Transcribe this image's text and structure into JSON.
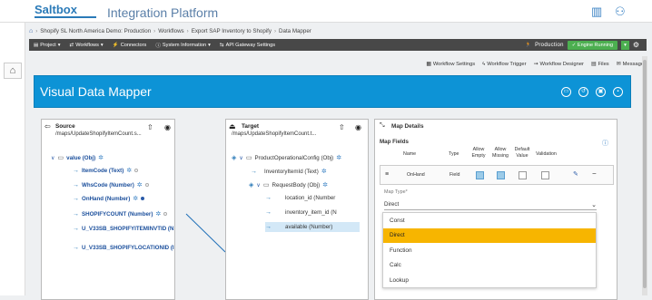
{
  "app": {
    "brand": "Saltbox",
    "title": "Integration Platform"
  },
  "breadcrumb": [
    "Shopify SL North America Demo: Production",
    "Workflows",
    "Export SAP Inventory to Shopify",
    "Data Mapper"
  ],
  "navbar": {
    "items": [
      {
        "label": "Project",
        "icon": "folder-icon"
      },
      {
        "label": "Workflows",
        "icon": "workflow-icon"
      },
      {
        "label": "Connectors",
        "icon": "connector-icon"
      },
      {
        "label": "System Information",
        "icon": "info-icon"
      },
      {
        "label": "API Gateway Settings",
        "icon": "api-icon"
      }
    ],
    "environment": "Production",
    "engine_status": "Engine Running"
  },
  "toolbar": [
    "Workflow Settings",
    "Workflow Trigger",
    "Workflow Designer",
    "Files",
    "Messages"
  ],
  "mapper": {
    "title": "Visual Data Mapper"
  },
  "source": {
    "title": "Source",
    "path": "/maps/UpdateShopifyItemCount.s...",
    "nodes": [
      {
        "label": "value (Obj)"
      },
      {
        "label": "ItemCode (Text)"
      },
      {
        "label": "WhsCode (Number)"
      },
      {
        "label": "OnHand (Number)"
      },
      {
        "label": "SHOPIFYCOUNT (Number)"
      },
      {
        "label": "U_V33SB_SHOPIFYITEMINVTID (N"
      },
      {
        "label": "U_V33SB_SHOPIFYLOCATIONID (I"
      }
    ]
  },
  "target": {
    "title": "Target",
    "path": "/maps/UpdateShopifyItemCount.t...",
    "nodes": [
      {
        "label": "ProductOperationalConfig (Obj)"
      },
      {
        "label": "InventoryItemId (Text)"
      },
      {
        "label": "RequestBody (Obj)"
      },
      {
        "label": "location_id (Number"
      },
      {
        "label": "inventory_item_id (N"
      },
      {
        "label": "available (Number)"
      }
    ]
  },
  "map_details": {
    "title": "Map Details",
    "fields_title": "Map Fields",
    "columns": [
      "Name",
      "Type",
      "Allow Empty",
      "Allow Missing",
      "Default Value",
      "Validation"
    ],
    "row": {
      "name": "OnHand",
      "type": "Field",
      "allow_empty": true,
      "allow_missing": true,
      "default_value": false,
      "validation": false
    },
    "map_type_label": "Map Type*",
    "map_type_value": "Direct",
    "options": [
      "Const",
      "Direct",
      "Function",
      "Calc",
      "Lookup"
    ],
    "selected_option": "Direct"
  },
  "colors": {
    "brand": "#2a7ab8",
    "header": "#0d93d6",
    "navbar": "#484848",
    "engine": "#4caf50",
    "selected_option": "#f7b500"
  }
}
